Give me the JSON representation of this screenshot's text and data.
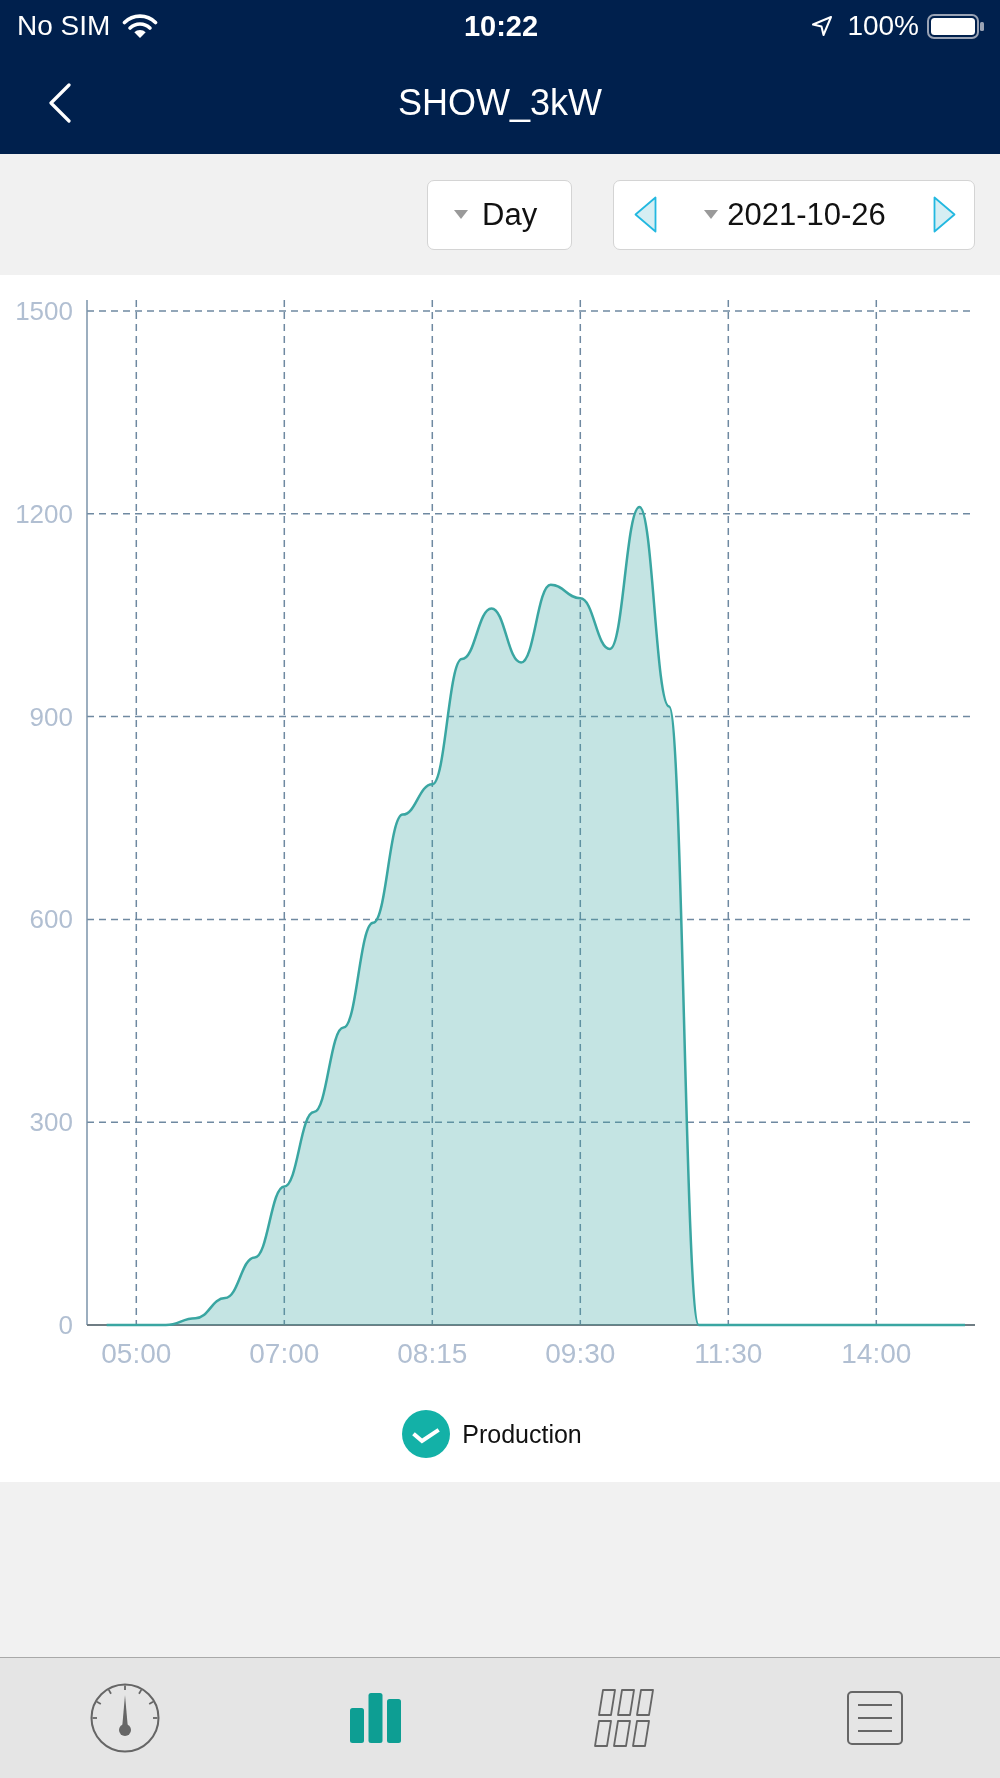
{
  "status_bar": {
    "carrier": "No SIM",
    "time": "10:22",
    "battery": "100%"
  },
  "nav_bar": {
    "title": "SHOW_3kW"
  },
  "filters": {
    "period": "Day",
    "date": "2021-10-26"
  },
  "chart": {
    "legend": {
      "checked": true
    },
    "chart_data": {
      "type": "area",
      "grid": true,
      "categories": [
        null,
        "05:00",
        null,
        null,
        null,
        null,
        "07:00",
        null,
        null,
        null,
        null,
        "08:15",
        null,
        null,
        null,
        null,
        "09:30",
        null,
        null,
        null,
        null,
        "11:30",
        null,
        null,
        null,
        null,
        "14:00",
        null,
        null,
        null
      ],
      "ylim": [
        0,
        1500
      ],
      "yticks": [
        0,
        300,
        600,
        900,
        1200,
        1500
      ],
      "series": [
        {
          "name": "Production",
          "color": "#3aa6a2",
          "values": [
            0,
            0,
            0,
            10,
            40,
            100,
            205,
            315,
            440,
            595,
            755,
            800,
            985,
            1060,
            980,
            1095,
            1075,
            1000,
            1210,
            915,
            0,
            0,
            0,
            0,
            0,
            0,
            0,
            0,
            0,
            0
          ]
        }
      ]
    }
  },
  "tab_bar": [
    {
      "kind": "gauge",
      "selected": false
    },
    {
      "kind": "bar_chart",
      "selected": true
    },
    {
      "kind": "panels",
      "selected": false
    },
    {
      "kind": "document",
      "selected": false
    }
  ]
}
